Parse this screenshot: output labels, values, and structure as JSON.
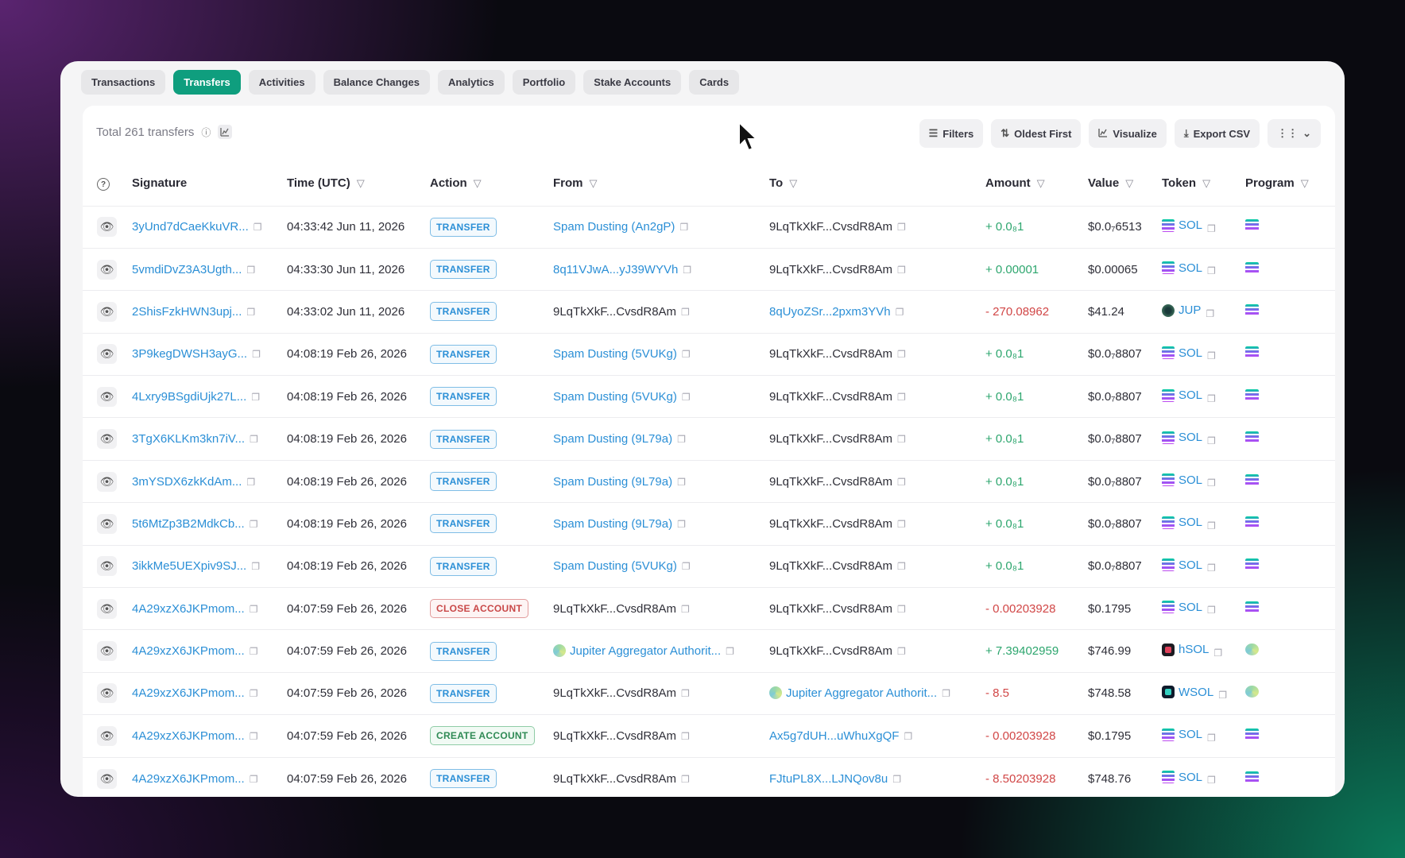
{
  "tabs": [
    "Transactions",
    "Transfers",
    "Activities",
    "Balance Changes",
    "Analytics",
    "Portfolio",
    "Stake Accounts",
    "Cards"
  ],
  "active_tab": "Transfers",
  "summary": {
    "label": "Total 261 transfers"
  },
  "actions": {
    "filters": "Filters",
    "sort": "Oldest First",
    "visualize": "Visualize",
    "export": "Export CSV"
  },
  "columns": {
    "signature": "Signature",
    "time": "Time (UTC)",
    "action": "Action",
    "from": "From",
    "to": "To",
    "amount": "Amount",
    "value": "Value",
    "token": "Token",
    "program": "Program"
  },
  "rows": [
    {
      "signature": "3yUnd7dCaeKkuVR...",
      "time": "04:33:42 Jun 11, 2026",
      "action": "TRANSFER",
      "action_kind": "transfer",
      "from": "Spam Dusting (An2gP)",
      "from_link": true,
      "to": "9LqTkXkF...CvsdR8Am",
      "to_link": false,
      "amount_text": "+ 0.0₈1",
      "amount_sign": "pos",
      "value": "$0.0₇6513",
      "token": "SOL",
      "token_icon": "sol",
      "program_icon": "sol"
    },
    {
      "signature": "5vmdiDvZ3A3Ugth...",
      "time": "04:33:30 Jun 11, 2026",
      "action": "TRANSFER",
      "action_kind": "transfer",
      "from": "8q11VJwA...yJ39WYVh",
      "from_link": true,
      "to": "9LqTkXkF...CvsdR8Am",
      "to_link": false,
      "amount_text": "+ 0.00001",
      "amount_sign": "pos",
      "value": "$0.00065",
      "token": "SOL",
      "token_icon": "sol",
      "program_icon": "sol"
    },
    {
      "signature": "2ShisFzkHWN3upj...",
      "time": "04:33:02 Jun 11, 2026",
      "action": "TRANSFER",
      "action_kind": "transfer",
      "from": "9LqTkXkF...CvsdR8Am",
      "from_link": false,
      "to": "8qUyoZSr...2pxm3YVh",
      "to_link": true,
      "amount_text": "- 270.08962",
      "amount_sign": "neg",
      "value": "$41.24",
      "token": "JUP",
      "token_icon": "jup",
      "program_icon": "sol"
    },
    {
      "signature": "3P9kegDWSH3ayG...",
      "time": "04:08:19 Feb 26, 2026",
      "action": "TRANSFER",
      "action_kind": "transfer",
      "from": "Spam Dusting (5VUKg)",
      "from_link": true,
      "to": "9LqTkXkF...CvsdR8Am",
      "to_link": false,
      "amount_text": "+ 0.0₈1",
      "amount_sign": "pos",
      "value": "$0.0₇8807",
      "token": "SOL",
      "token_icon": "sol",
      "program_icon": "sol"
    },
    {
      "signature": "4Lxry9BSgdiUjk27L...",
      "time": "04:08:19 Feb 26, 2026",
      "action": "TRANSFER",
      "action_kind": "transfer",
      "from": "Spam Dusting (5VUKg)",
      "from_link": true,
      "to": "9LqTkXkF...CvsdR8Am",
      "to_link": false,
      "amount_text": "+ 0.0₈1",
      "amount_sign": "pos",
      "value": "$0.0₇8807",
      "token": "SOL",
      "token_icon": "sol",
      "program_icon": "sol"
    },
    {
      "signature": "3TgX6KLKm3kn7iV...",
      "time": "04:08:19 Feb 26, 2026",
      "action": "TRANSFER",
      "action_kind": "transfer",
      "from": "Spam Dusting (9L79a)",
      "from_link": true,
      "to": "9LqTkXkF...CvsdR8Am",
      "to_link": false,
      "amount_text": "+ 0.0₈1",
      "amount_sign": "pos",
      "value": "$0.0₇8807",
      "token": "SOL",
      "token_icon": "sol",
      "program_icon": "sol"
    },
    {
      "signature": "3mYSDX6zkKdAm...",
      "time": "04:08:19 Feb 26, 2026",
      "action": "TRANSFER",
      "action_kind": "transfer",
      "from": "Spam Dusting (9L79a)",
      "from_link": true,
      "to": "9LqTkXkF...CvsdR8Am",
      "to_link": false,
      "amount_text": "+ 0.0₈1",
      "amount_sign": "pos",
      "value": "$0.0₇8807",
      "token": "SOL",
      "token_icon": "sol",
      "program_icon": "sol"
    },
    {
      "signature": "5t6MtZp3B2MdkCb...",
      "time": "04:08:19 Feb 26, 2026",
      "action": "TRANSFER",
      "action_kind": "transfer",
      "from": "Spam Dusting (9L79a)",
      "from_link": true,
      "to": "9LqTkXkF...CvsdR8Am",
      "to_link": false,
      "amount_text": "+ 0.0₈1",
      "amount_sign": "pos",
      "value": "$0.0₇8807",
      "token": "SOL",
      "token_icon": "sol",
      "program_icon": "sol"
    },
    {
      "signature": "3ikkMe5UEXpiv9SJ...",
      "time": "04:08:19 Feb 26, 2026",
      "action": "TRANSFER",
      "action_kind": "transfer",
      "from": "Spam Dusting (5VUKg)",
      "from_link": true,
      "to": "9LqTkXkF...CvsdR8Am",
      "to_link": false,
      "amount_text": "+ 0.0₈1",
      "amount_sign": "pos",
      "value": "$0.0₇8807",
      "token": "SOL",
      "token_icon": "sol",
      "program_icon": "sol"
    },
    {
      "signature": "4A29xzX6JKPmom...",
      "time": "04:07:59 Feb 26, 2026",
      "action": "CLOSE ACCOUNT",
      "action_kind": "close",
      "from": "9LqTkXkF...CvsdR8Am",
      "from_link": false,
      "to": "9LqTkXkF...CvsdR8Am",
      "to_link": false,
      "amount_text": "- 0.00203928",
      "amount_sign": "neg",
      "value": "$0.1795",
      "token": "SOL",
      "token_icon": "sol",
      "program_icon": "sol"
    },
    {
      "signature": "4A29xzX6JKPmom...",
      "time": "04:07:59 Feb 26, 2026",
      "action": "TRANSFER",
      "action_kind": "transfer",
      "from": "Jupiter Aggregator Authorit...",
      "from_link": true,
      "from_icon": true,
      "to": "9LqTkXkF...CvsdR8Am",
      "to_link": false,
      "amount_text": "+ 7.39402959",
      "amount_sign": "pos",
      "value": "$746.99",
      "token": "hSOL",
      "token_icon": "hsol",
      "program_icon": "jupa"
    },
    {
      "signature": "4A29xzX6JKPmom...",
      "time": "04:07:59 Feb 26, 2026",
      "action": "TRANSFER",
      "action_kind": "transfer",
      "from": "9LqTkXkF...CvsdR8Am",
      "from_link": false,
      "to": "Jupiter Aggregator Authorit...",
      "to_link": true,
      "to_icon": true,
      "amount_text": "- 8.5",
      "amount_sign": "neg",
      "value": "$748.58",
      "token": "WSOL",
      "token_icon": "wsol",
      "program_icon": "jupa"
    },
    {
      "signature": "4A29xzX6JKPmom...",
      "time": "04:07:59 Feb 26, 2026",
      "action": "CREATE ACCOUNT",
      "action_kind": "create",
      "from": "9LqTkXkF...CvsdR8Am",
      "from_link": false,
      "to": "Ax5g7dUH...uWhuXgQF",
      "to_link": true,
      "amount_text": "- 0.00203928",
      "amount_sign": "neg",
      "value": "$0.1795",
      "token": "SOL",
      "token_icon": "sol",
      "program_icon": "sol"
    },
    {
      "signature": "4A29xzX6JKPmom...",
      "time": "04:07:59 Feb 26, 2026",
      "action": "TRANSFER",
      "action_kind": "transfer",
      "from": "9LqTkXkF...CvsdR8Am",
      "from_link": false,
      "to": "FJtuPL8X...LJNQov8u",
      "to_link": true,
      "amount_text": "- 8.50203928",
      "amount_sign": "neg",
      "value": "$748.76",
      "token": "SOL",
      "token_icon": "sol",
      "program_icon": "sol"
    }
  ],
  "colors": {
    "accent": "#0f9e7e",
    "link": "#2b8fd6",
    "positive": "#2da66e",
    "negative": "#d14646"
  },
  "icons": {
    "eye": "eye-icon",
    "copy": "copy-icon",
    "filter": "filter-icon",
    "info": "info-icon"
  }
}
